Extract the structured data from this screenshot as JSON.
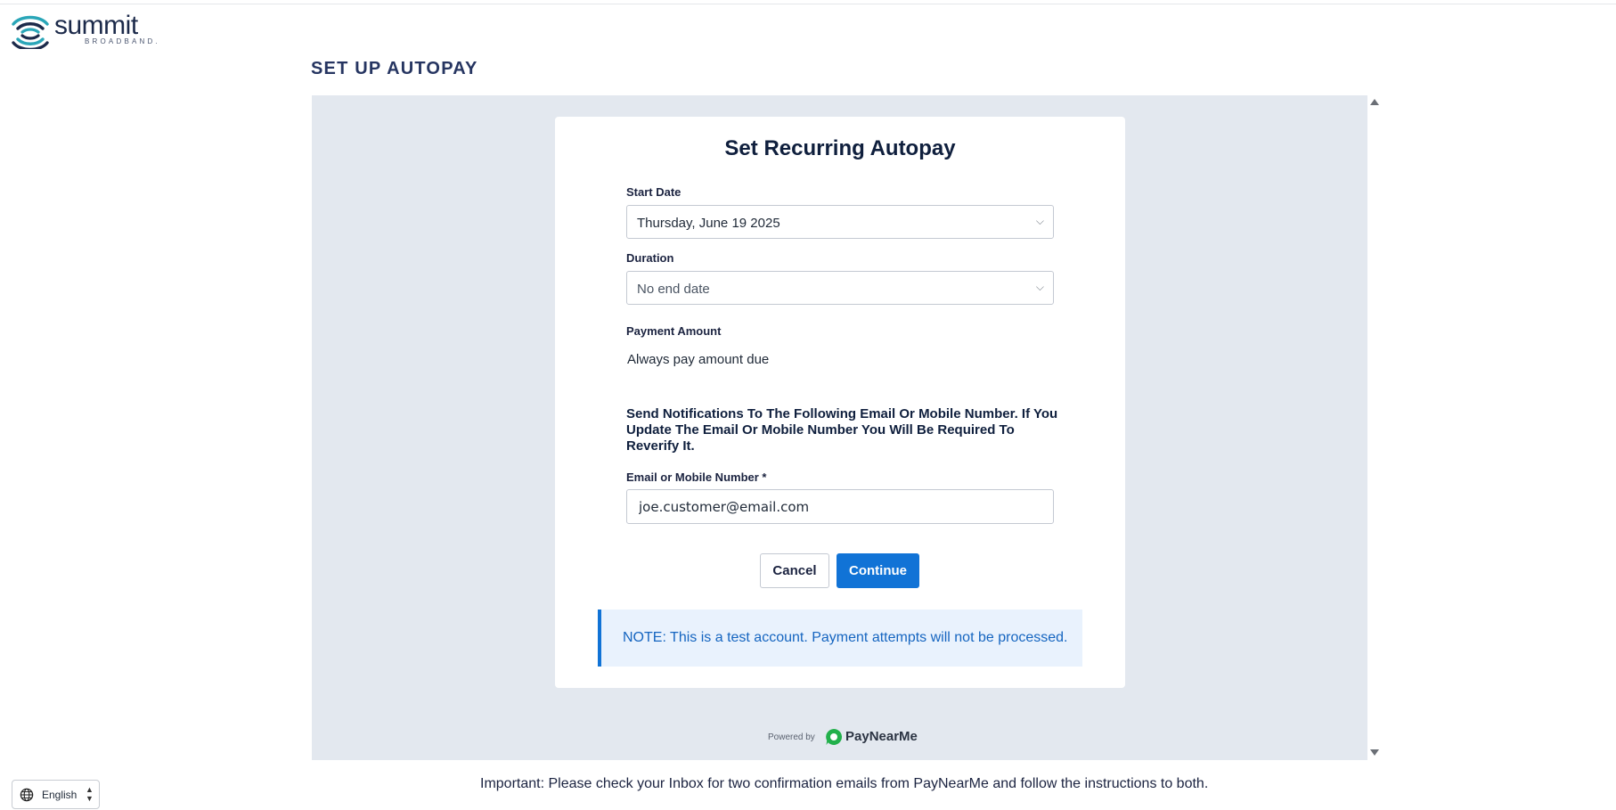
{
  "brand": {
    "name": "summit",
    "tagline": "BROADBAND.",
    "primary_color": "#1c2a4a",
    "accent_color": "#2aa6b8"
  },
  "page": {
    "heading": "SET UP AUTOPAY"
  },
  "form": {
    "title": "Set Recurring Autopay",
    "start_date": {
      "label": "Start Date",
      "value": "Thursday, June 19 2025"
    },
    "duration": {
      "label": "Duration",
      "value": "No end date"
    },
    "payment_amount": {
      "label": "Payment Amount",
      "value": "Always pay amount due"
    },
    "notification_text": "Send Notifications To The Following Email Or Mobile Number. If You Update The Email Or Mobile Number You Will Be Required To Reverify It.",
    "contact": {
      "label": "Email or Mobile Number *",
      "value": "joe.customer@email.com"
    },
    "cancel_label": "Cancel",
    "continue_label": "Continue",
    "continue_color": "#1173d6",
    "note": "NOTE: This is a test account. Payment attempts will not be processed."
  },
  "footer": {
    "powered_by": "Powered by",
    "provider": "PayNearMe",
    "provider_color": "#22b04b",
    "important": "Important: Please check your Inbox for two confirmation emails from PayNearMe and follow the instructions to both."
  },
  "language": {
    "selected": "English",
    "icon": "globe-icon"
  }
}
